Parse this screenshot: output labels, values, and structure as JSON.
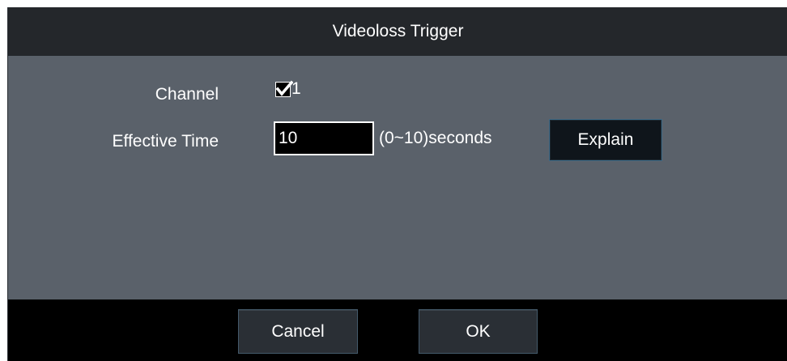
{
  "dialog": {
    "title": "Videoloss Trigger"
  },
  "form": {
    "channel_label": "Channel",
    "channel_checkbox": {
      "checked": true,
      "label": "1"
    },
    "effective_time_label": "Effective Time",
    "effective_time_value": "10",
    "range_text": "(0~10)seconds",
    "explain_label": "Explain"
  },
  "footer": {
    "cancel_label": "Cancel",
    "ok_label": "OK"
  },
  "colors": {
    "title_bar": "#24272b",
    "body": "#5a616a",
    "footer": "#000000",
    "button_border": "#445a6b"
  },
  "icons": {
    "checkbox_mark": "check-icon"
  }
}
